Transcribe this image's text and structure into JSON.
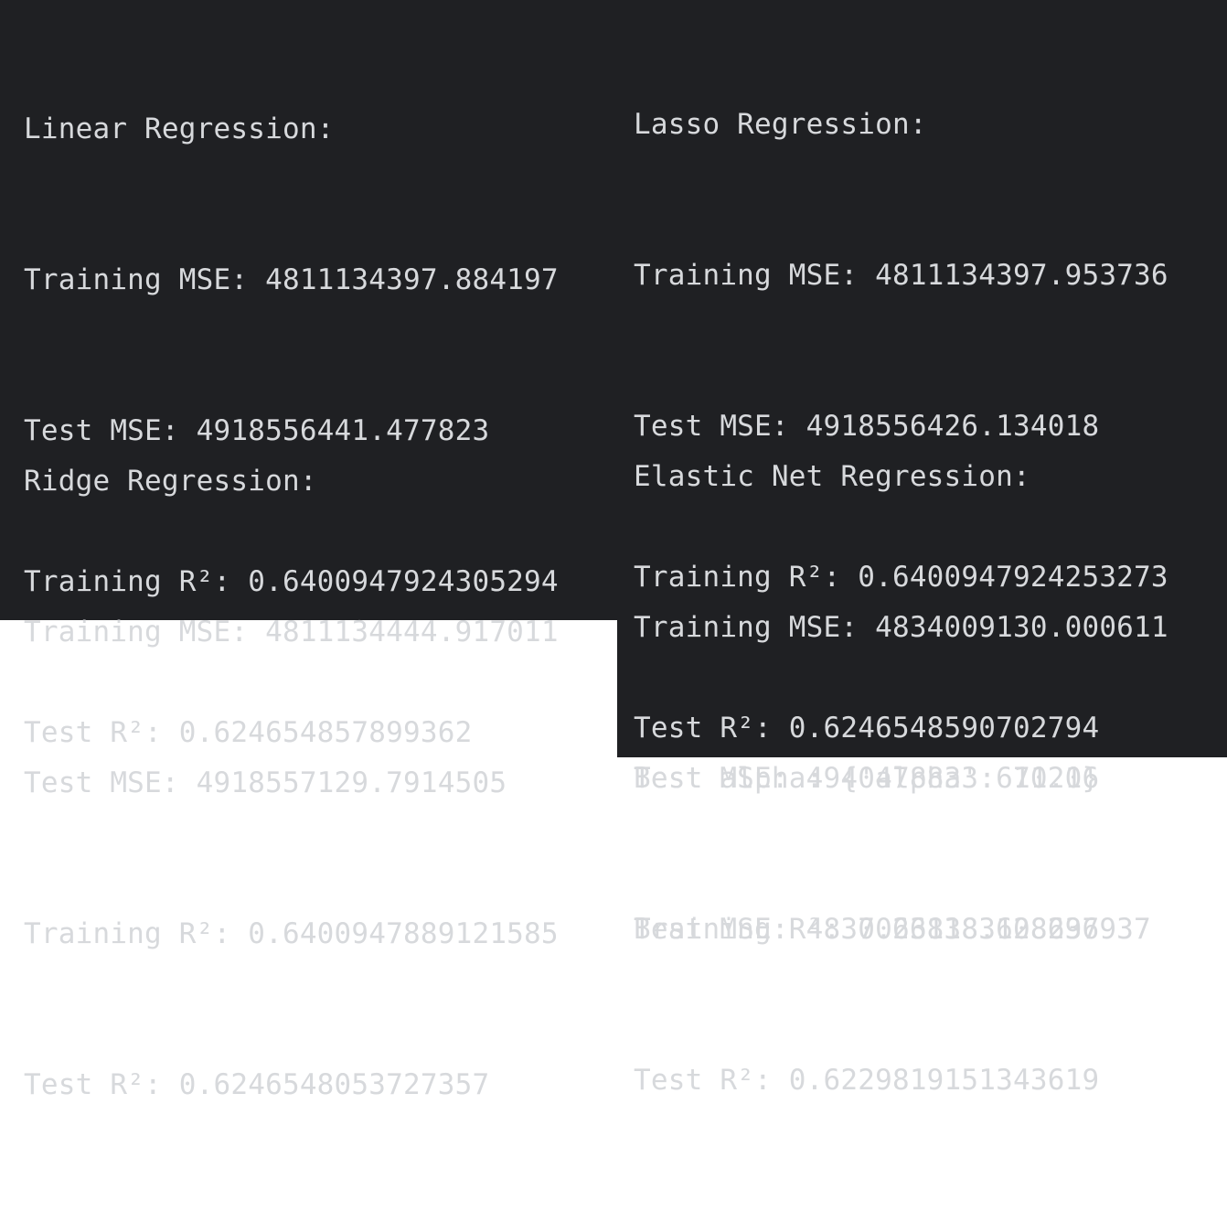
{
  "console": {
    "linear": {
      "title": "Linear Regression:",
      "training_mse": "Training MSE: 4811134397.884197",
      "test_mse": "Test MSE: 4918556441.477823",
      "training_r2": "Training R²: 0.6400947924305294",
      "test_r2": "Test R²: 0.624654857899362"
    },
    "lasso": {
      "title": "Lasso Regression:",
      "training_mse": "Training MSE: 4811134397.953736",
      "test_mse": "Test MSE: 4918556426.134018",
      "training_r2": "Training R²: 0.6400947924253273",
      "test_r2": "Test R²: 0.6246548590702794"
    },
    "ridge": {
      "title": "Ridge Regression:",
      "training_mse": "Training MSE: 4811134444.917011",
      "test_mse": "Test MSE: 4918557129.7914505",
      "training_r2": "Training R²: 0.6400947889121585",
      "test_r2": "Test R²: 0.6246548053727357"
    },
    "elastic": {
      "title": "Elastic Net Regression:",
      "training_mse": "Training MSE: 4834009130.000611",
      "test_mse": "Test MSE: 4940478833.671216",
      "training_r2": "Training R²: 0.638383608636937",
      "test_r2": "Test R²: 0.6229819151343619"
    },
    "best": {
      "alpha": "Best alpha: {'alpha': 10.0}",
      "mse": "Best MSE: 4837026118.128297"
    }
  },
  "colors": {
    "background": "#1f2023",
    "text": "#d7d9dc",
    "page": "#ffffff"
  }
}
